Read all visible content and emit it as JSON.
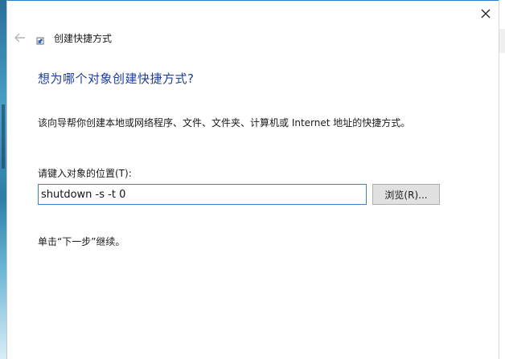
{
  "window": {
    "title": "创建快捷方式",
    "heading": "想为哪个对象创建快捷方式?",
    "description": "该向导帮你创建本地或网络程序、文件、文件夹、计算机或 Internet 地址的快捷方式。",
    "location_label": "请键入对象的位置(T):",
    "location_value": "shutdown -s -t 0",
    "browse_label": "浏览(R)...",
    "hint": "单击“下一步”继续。"
  },
  "icons": {
    "close": "close-icon",
    "back": "back-arrow-icon",
    "title": "shortcut-icon"
  },
  "colors": {
    "heading": "#1e3f99",
    "input_border": "#3a7fd1",
    "button_bg": "#e1e1e1"
  }
}
